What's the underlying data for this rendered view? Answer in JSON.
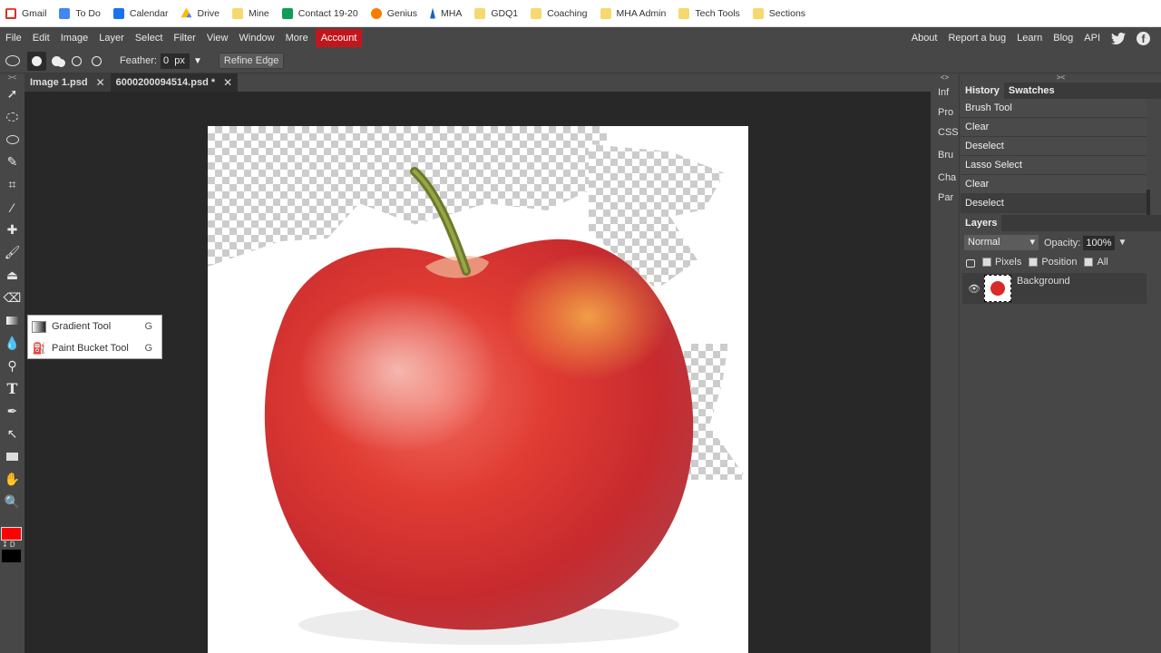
{
  "bookmarks": [
    {
      "label": "Gmail",
      "icon": "gmail-icon",
      "color": "#d93025"
    },
    {
      "label": "To Do",
      "icon": "docs-icon",
      "color": "#4285f4"
    },
    {
      "label": "Calendar",
      "icon": "calendar-icon",
      "color": "#1a73e8"
    },
    {
      "label": "Drive",
      "icon": "drive-icon",
      "color": "#0f9d58"
    },
    {
      "label": "Mine",
      "icon": "folder-icon",
      "color": "#f6d96e"
    },
    {
      "label": "Contact 19-20",
      "icon": "sheets-icon",
      "color": "#0f9d58"
    },
    {
      "label": "Genius",
      "icon": "genius-icon",
      "color": "#f57c00"
    },
    {
      "label": "MHA",
      "icon": "mha-icon",
      "color": "#1565c0"
    },
    {
      "label": "GDQ1",
      "icon": "folder-icon",
      "color": "#f6d96e"
    },
    {
      "label": "Coaching",
      "icon": "folder-icon",
      "color": "#f6d96e"
    },
    {
      "label": "MHA Admin",
      "icon": "folder-icon",
      "color": "#f6d96e"
    },
    {
      "label": "Tech Tools",
      "icon": "folder-icon",
      "color": "#f6d96e"
    },
    {
      "label": "Sections",
      "icon": "folder-icon",
      "color": "#f6d96e"
    }
  ],
  "menu": [
    "File",
    "Edit",
    "Image",
    "Layer",
    "Select",
    "Filter",
    "View",
    "Window",
    "More",
    "Account"
  ],
  "menu_right": [
    "About",
    "Report a bug",
    "Learn",
    "Blog",
    "API"
  ],
  "options": {
    "feather_label": "Feather:",
    "feather_value": "0",
    "feather_unit": "px",
    "refine_label": "Refine Edge"
  },
  "tabs": [
    {
      "label": "Image 1.psd",
      "close": "✕"
    },
    {
      "label": "6000200094514.psd *",
      "close": "✕"
    }
  ],
  "flyout": [
    {
      "label": "Gradient Tool",
      "key": "G"
    },
    {
      "label": "Paint Bucket Tool",
      "key": "G"
    }
  ],
  "mini_panels": [
    "Inf",
    "Pro",
    "CSS",
    "Bru",
    "Cha",
    "Par"
  ],
  "history_tabs": [
    "History",
    "Swatches"
  ],
  "history": [
    "Brush Tool",
    "Clear",
    "Deselect",
    "Lasso Select",
    "Clear",
    "Deselect"
  ],
  "layers": {
    "tab": "Layers",
    "blend_mode": "Normal",
    "opacity_label": "Opacity:",
    "opacity_value": "100%",
    "lock_pixels": "Pixels",
    "lock_position": "Position",
    "lock_all": "All",
    "items": [
      {
        "name": "Background"
      }
    ]
  },
  "colors": {
    "foreground": "#ff0000",
    "background": "#000000",
    "accent": "#c3161c"
  },
  "swatch_label": "↧ D",
  "panel_toggle": "<>",
  "panel_toggle_right": "><",
  "toolbar_toggle": "><"
}
